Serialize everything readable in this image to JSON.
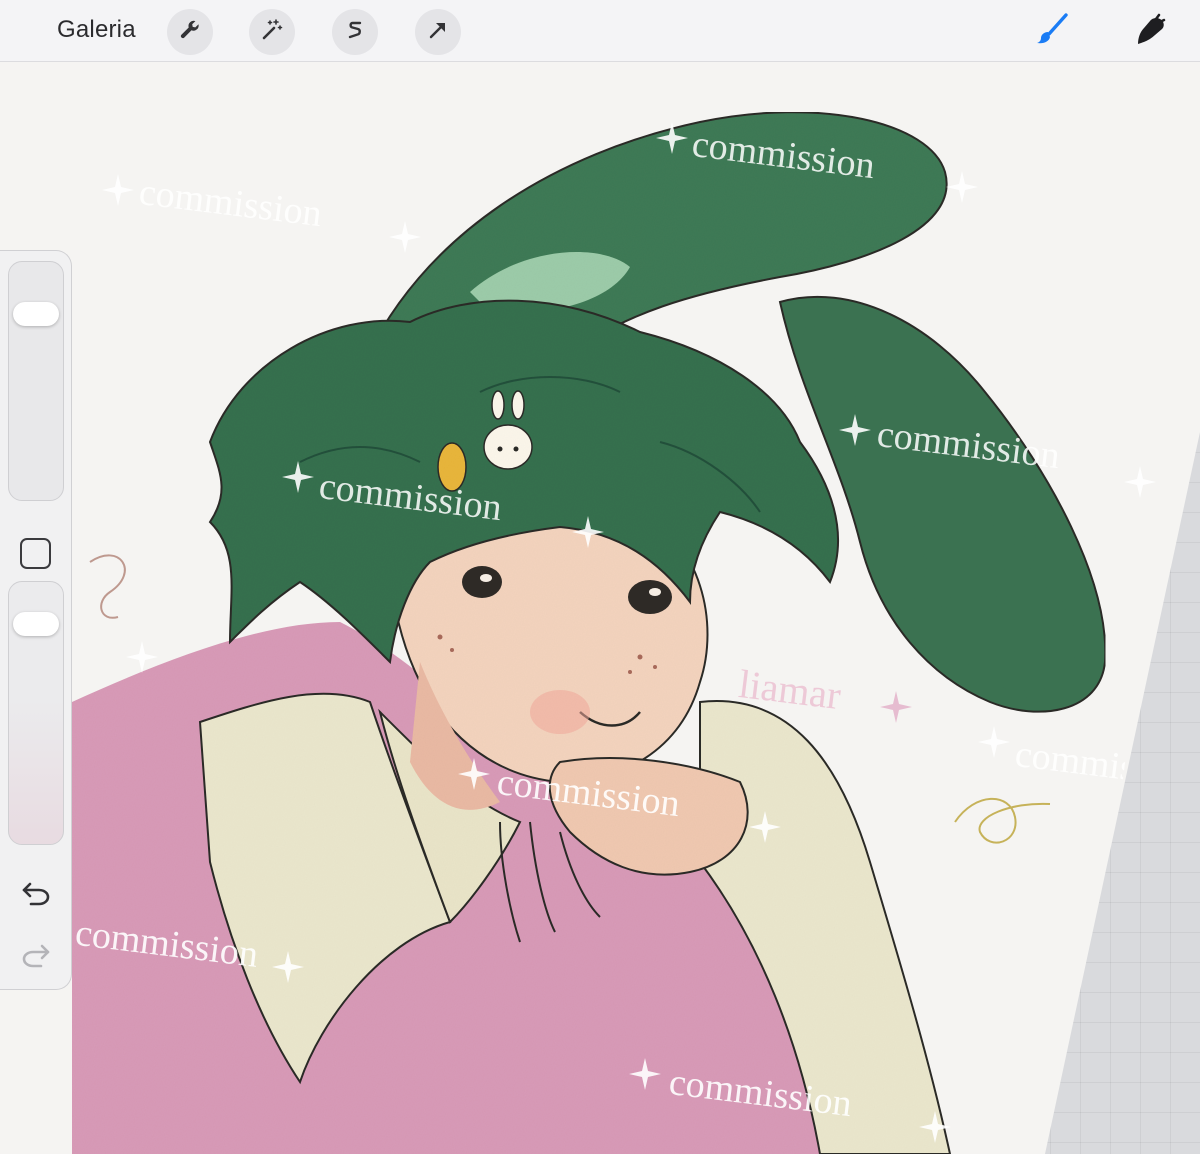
{
  "toolbar": {
    "gallery_label": "Galeria",
    "left_tools": [
      "wrench-icon",
      "magic-wand-icon",
      "selection-icon",
      "transform-arrow-icon"
    ],
    "right_tools": [
      "brush-icon",
      "smudge-icon"
    ],
    "active_tool": "brush-icon",
    "accent_color": "#1a7cf5"
  },
  "sidebar": {
    "brush_size": 0.9,
    "brush_opacity": 0.98,
    "buttons": [
      "modify-square-icon",
      "undo-icon",
      "redo-icon"
    ]
  },
  "watermarks": {
    "commission": "commission",
    "artist": "liamar"
  },
  "colors": {
    "hair": "#35704e",
    "skin": "#f3d3bd",
    "sweater_vest": "#d89ab7",
    "shirt": "#eae6cc",
    "canvas_paper": "#f5f4f2"
  }
}
